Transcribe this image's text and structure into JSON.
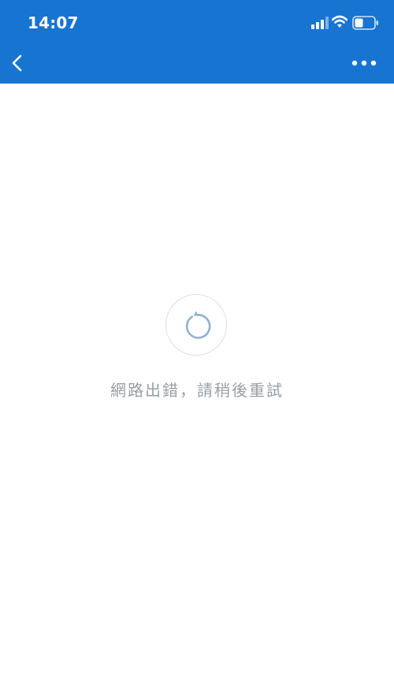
{
  "status_bar": {
    "time": "14:07",
    "icons": [
      "signal-icon",
      "wifi-icon",
      "battery-icon"
    ]
  },
  "nav": {
    "back_icon": "chevron-left-icon",
    "more_icon": "more-horizontal-icon"
  },
  "error": {
    "retry_icon": "refresh-icon",
    "message": "網路出錯，請稍後重試"
  },
  "colors": {
    "header": "#1874d1",
    "background": "#ffffff",
    "message_text": "#9a9ea4",
    "retry_icon": "#8fb0d2",
    "retry_border": "#d9dde2"
  }
}
